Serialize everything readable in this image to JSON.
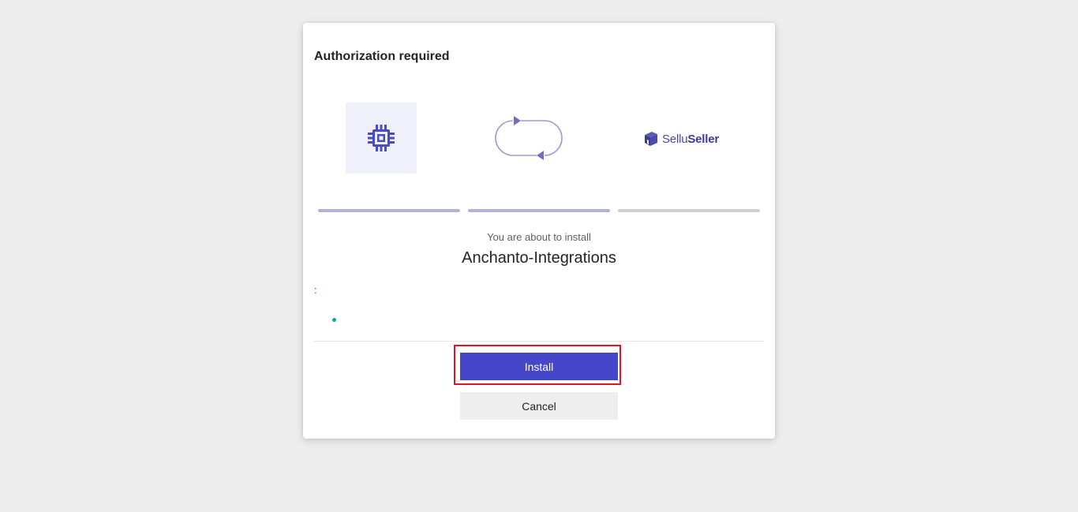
{
  "dialog": {
    "title": "Authorization required",
    "brand": {
      "prefix": "Sellu",
      "suffix": "Seller"
    },
    "progress_colors": [
      "#b1b1de",
      "#b1b1de",
      "#cfcfd6"
    ],
    "subtitle": "You are about to install",
    "app_name": "Anchanto-Integrations",
    "permissions_label": ":",
    "install_label": "Install",
    "cancel_label": "Cancel"
  },
  "colors": {
    "accent": "#4646c8",
    "highlight": "#e81123",
    "bullet": "#13a3a3"
  },
  "icons": [
    "chip-icon",
    "sync-arrows-icon",
    "selluseller-logo-icon"
  ]
}
